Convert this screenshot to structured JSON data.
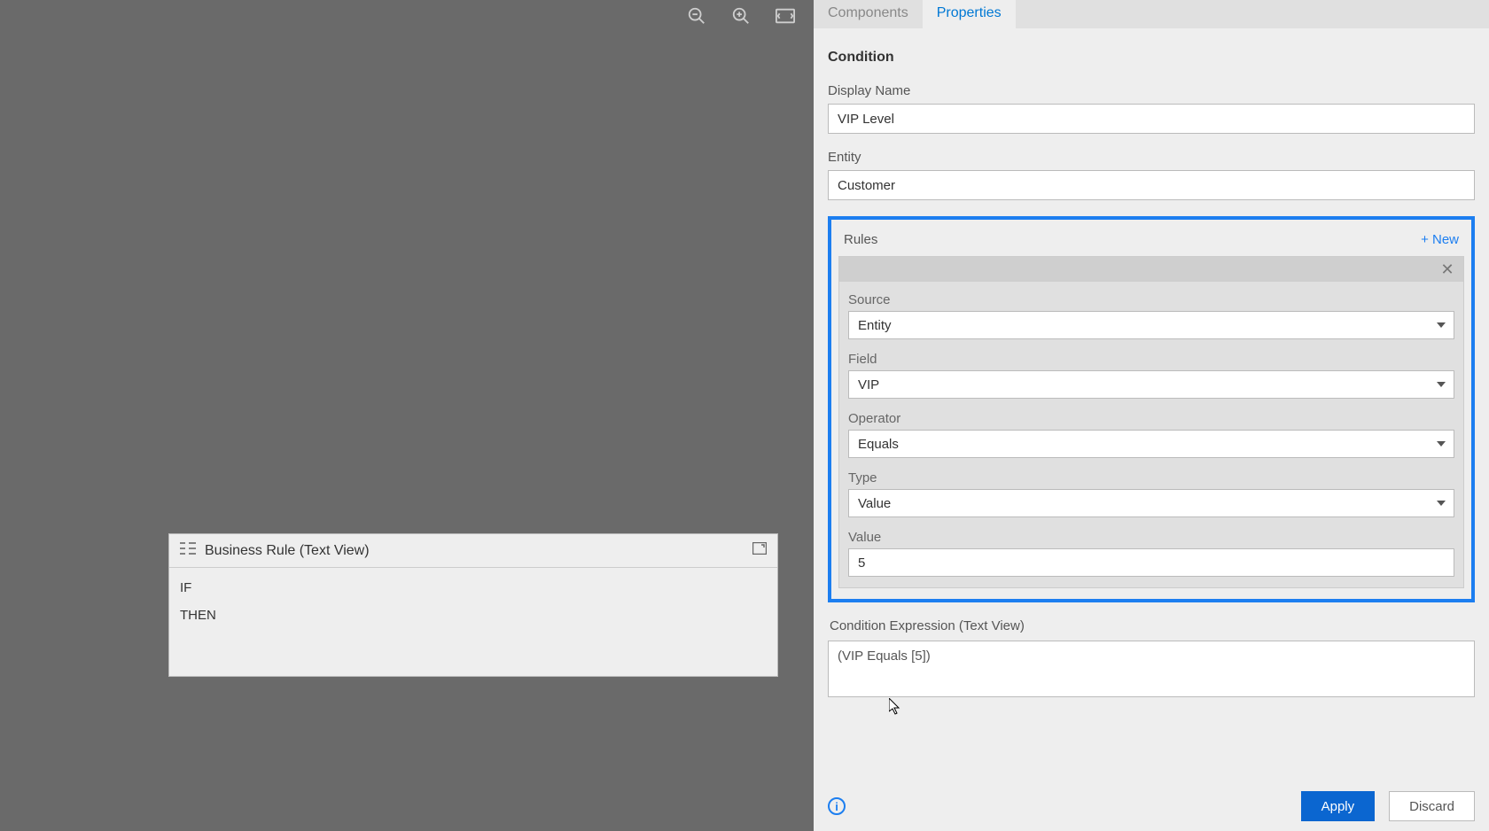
{
  "canvas": {
    "textView": {
      "title": "Business Rule (Text View)",
      "if": "IF",
      "then": "THEN"
    }
  },
  "panel": {
    "tabs": {
      "components": "Components",
      "properties": "Properties"
    },
    "section_title": "Condition",
    "display_name": {
      "label": "Display Name",
      "value": "VIP Level"
    },
    "entity": {
      "label": "Entity",
      "value": "Customer"
    },
    "rules": {
      "label": "Rules",
      "new_label": "+ New",
      "source": {
        "label": "Source",
        "value": "Entity"
      },
      "field": {
        "label": "Field",
        "value": "VIP"
      },
      "operator": {
        "label": "Operator",
        "value": "Equals"
      },
      "type": {
        "label": "Type",
        "value": "Value"
      },
      "valuefld": {
        "label": "Value",
        "value": "5"
      }
    },
    "expression": {
      "label": "Condition Expression (Text View)",
      "value": "(VIP Equals [5])"
    },
    "buttons": {
      "apply": "Apply",
      "discard": "Discard"
    }
  }
}
